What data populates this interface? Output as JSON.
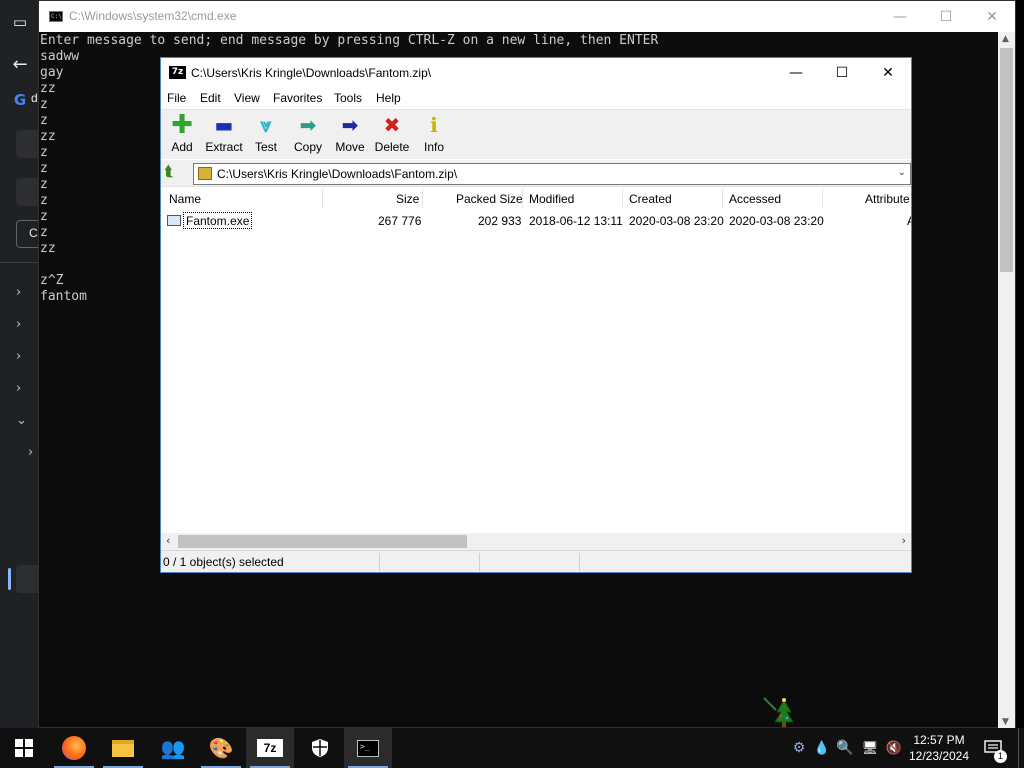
{
  "cmd": {
    "title": "C:\\Windows\\system32\\cmd.exe",
    "lines": [
      "Enter message to send; end message by pressing CTRL-Z on a new line, then ENTER",
      "sadww",
      "gay",
      "zz",
      "z",
      "z",
      "zz",
      "z",
      "z",
      "z",
      "z",
      "z",
      "z",
      "zz",
      "",
      "z^Z",
      "fantom"
    ]
  },
  "sidebar": {
    "partial_labels": {
      "g_item": "d",
      "c_item": "C"
    }
  },
  "zip": {
    "title": "C:\\Users\\Kris Kringle\\Downloads\\Fantom.zip\\",
    "logo_text": "7z",
    "menu": [
      "File",
      "Edit",
      "View",
      "Favorites",
      "Tools",
      "Help"
    ],
    "toolbar": [
      {
        "label": "Add",
        "icon": "plus-icon",
        "color": "#2fa52f"
      },
      {
        "label": "Extract",
        "icon": "minus-icon",
        "color": "#1c2fb5"
      },
      {
        "label": "Test",
        "icon": "check-down-icon",
        "color": "#2fb7c9"
      },
      {
        "label": "Copy",
        "icon": "arrow-right-icon",
        "color": "#2e9c8a"
      },
      {
        "label": "Move",
        "icon": "arrow-right-icon",
        "color": "#1b2a9c"
      },
      {
        "label": "Delete",
        "icon": "x-icon",
        "color": "#d21d1d"
      },
      {
        "label": "Info",
        "icon": "info-icon",
        "color": "#c5b400"
      }
    ],
    "address": "C:\\Users\\Kris Kringle\\Downloads\\Fantom.zip\\",
    "columns": [
      "Name",
      "Size",
      "Packed Size",
      "Modified",
      "Created",
      "Accessed",
      "Attribute"
    ],
    "files": [
      {
        "name": "Fantom.exe",
        "size": "267 776",
        "packed": "202 933",
        "modified": "2018-06-12 13:11",
        "created": "2020-03-08 23:20",
        "accessed": "2020-03-08 23:20",
        "attrib": "A"
      }
    ],
    "status": "0 / 1 object(s) selected"
  },
  "taskbar": {
    "apps": [
      {
        "name": "firefox",
        "active": false
      },
      {
        "name": "file-explorer",
        "active": false
      },
      {
        "name": "people",
        "active": false
      },
      {
        "name": "paint",
        "active": false
      },
      {
        "name": "7zip",
        "active": true
      },
      {
        "name": "defender",
        "active": false
      },
      {
        "name": "cmd",
        "active": true
      }
    ],
    "seven_zip_label": "7z",
    "time": "12:57 PM",
    "date": "12/23/2024",
    "notification_count": "1"
  }
}
